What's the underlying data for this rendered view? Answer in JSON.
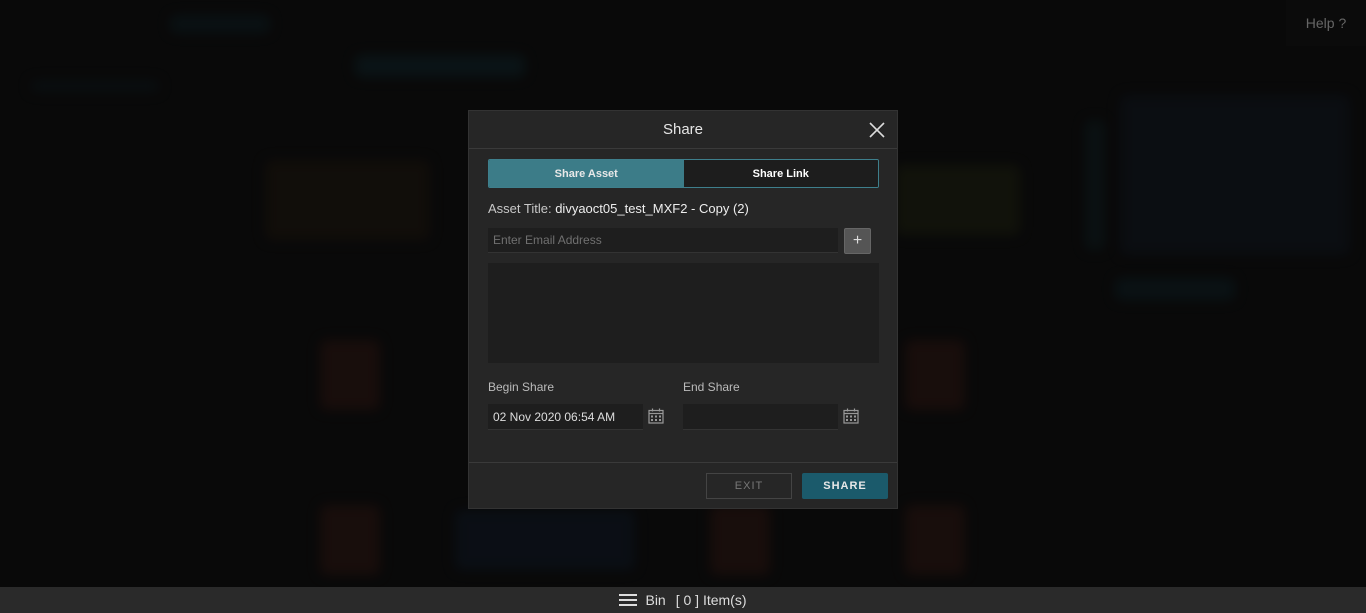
{
  "header": {
    "help_label": "Help ?"
  },
  "modal": {
    "title": "Share",
    "tabs": [
      {
        "label": "Share Asset",
        "active": true
      },
      {
        "label": "Share Link",
        "active": false
      }
    ],
    "asset_title_label": "Asset Title:",
    "asset_title_value": "divyaoct05_test_MXF2 - Copy (2)",
    "email_placeholder": "Enter Email Address",
    "email_value": "",
    "add_label": "+",
    "begin_share_label": "Begin Share",
    "begin_share_value": "02 Nov 2020 06:54 AM",
    "end_share_label": "End Share",
    "end_share_value": "",
    "exit_label": "EXIT",
    "share_label": "SHARE"
  },
  "bottom_bar": {
    "bin_label": "Bin",
    "count_text": "[ 0 ] Item(s)"
  },
  "colors": {
    "accent": "#3c7c88",
    "primary_button": "#1b5a6b",
    "modal_bg": "#262626"
  },
  "icons": {
    "close": "close-icon",
    "calendar": "calendar-icon",
    "menu": "hamburger-icon"
  }
}
